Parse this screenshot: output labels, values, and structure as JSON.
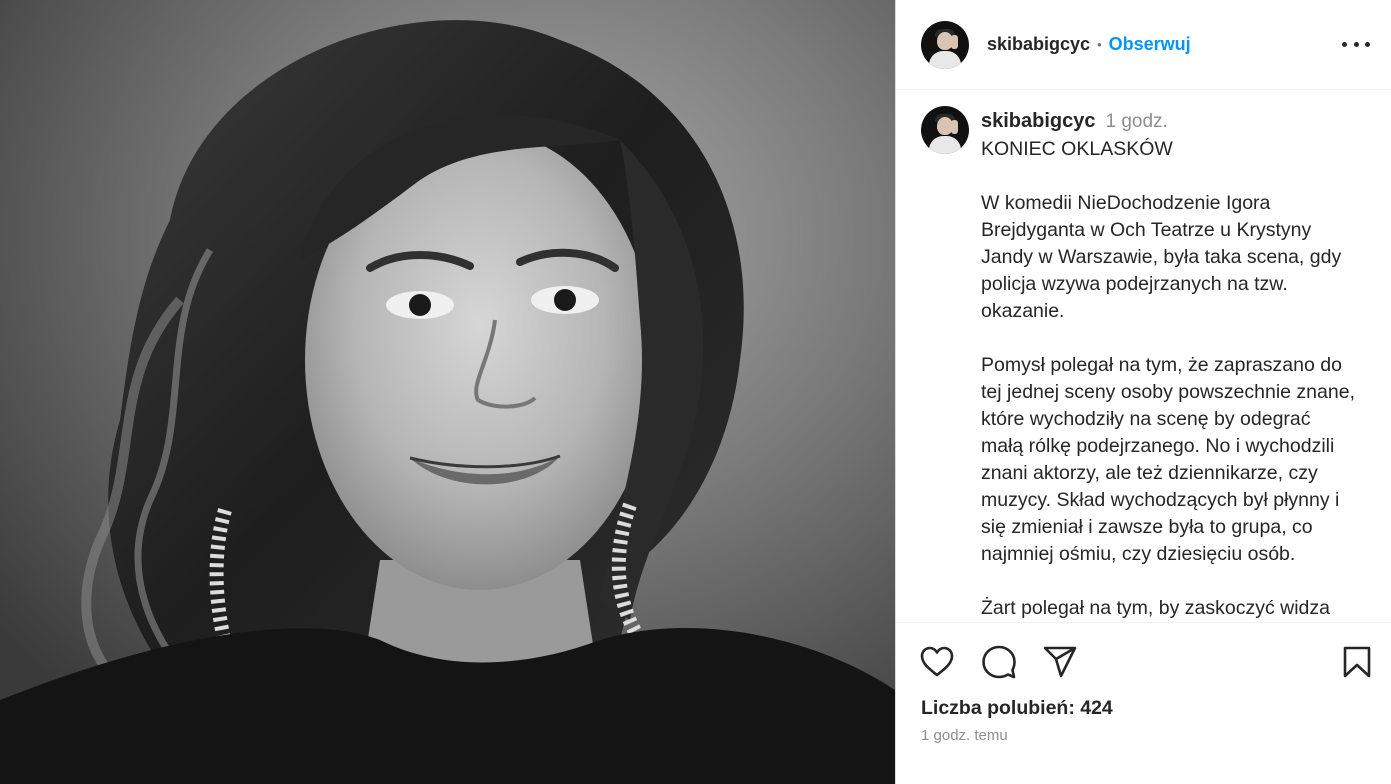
{
  "post": {
    "image_alt": "",
    "author": {
      "username": "skibabigcyc",
      "follow_label": "Obserwuj",
      "separator": "•"
    },
    "caption": {
      "username": "skibabigcyc",
      "time": "1 godz.",
      "title": "KONIEC OKLASKÓW",
      "paragraphs": [
        "W komedii NieDochodzenie Igora\nBrejdyganta w Och Teatrze u Krystyny\nJandy w Warszawie,  była taka scena, gdy\npolicja wzywa podejrzanych na tzw.\nokazanie.",
        "Pomysł polegał na tym, że zapraszano do\ntej jednej sceny osoby powszechnie znane,\nktóre wychodziły na scenę by odegrać\nmałą rólkę podejrzanego.  No i wychodzili\nznani aktorzy, ale też dziennikarze, czy\nmuzycy. Skład wychodzących był płynny i\nsię zmieniał i zawsze była to  grupa, co\nnajmniej ośmiu, czy dziesięciu osób.",
        "Żart polegał na tym, by zaskoczyć widza"
      ]
    },
    "likes_label": "Liczba polubień: 424",
    "timestamp": "1 godz. temu",
    "icons": {
      "more": "more-options-icon",
      "like": "heart-icon",
      "comment": "comment-icon",
      "share": "send-icon",
      "save": "bookmark-icon"
    },
    "colors": {
      "accent": "#0095f6",
      "text": "#262626",
      "muted": "#8e8e8e"
    }
  }
}
